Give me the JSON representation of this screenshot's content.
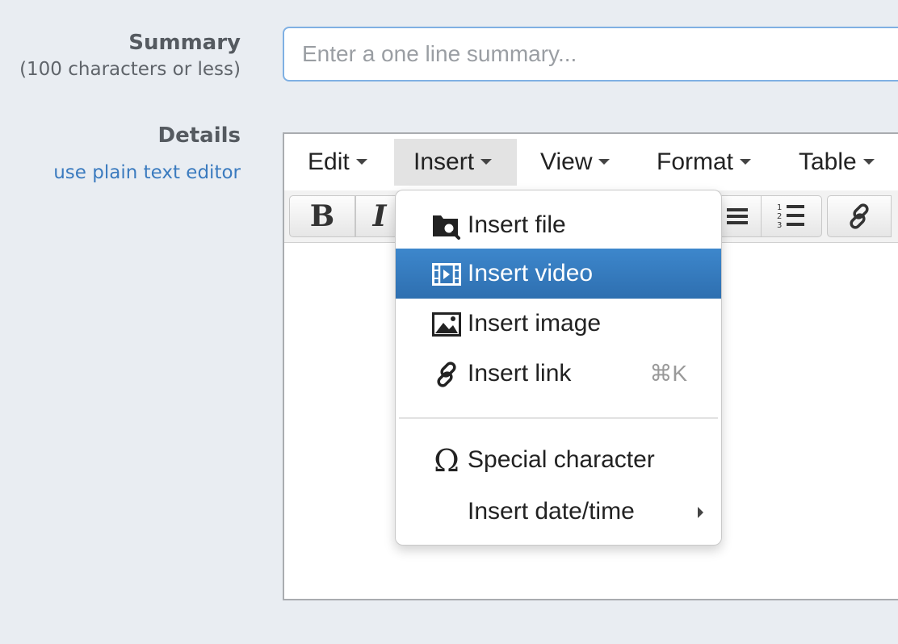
{
  "summary": {
    "label": "Summary",
    "sublabel": "(100 characters or less)",
    "placeholder": "Enter a one line summary...",
    "value": ""
  },
  "details": {
    "label": "Details",
    "plain_text_link": "use plain text editor"
  },
  "editor": {
    "menubar": [
      {
        "label": "Edit"
      },
      {
        "label": "Insert",
        "active": true
      },
      {
        "label": "View"
      },
      {
        "label": "Format"
      },
      {
        "label": "Table"
      }
    ],
    "toolbar": {
      "bold_label": "B",
      "italic_label": "I",
      "icons": [
        "bold-icon",
        "italic-icon",
        "bullet-list-icon",
        "numbered-list-icon",
        "link-icon"
      ]
    }
  },
  "insert_menu": {
    "items": [
      {
        "label": "Insert file",
        "icon": "folder-search-icon"
      },
      {
        "label": "Insert video",
        "icon": "film-icon",
        "highlighted": true
      },
      {
        "label": "Insert image",
        "icon": "image-icon"
      },
      {
        "label": "Insert link",
        "icon": "link-icon",
        "shortcut": "⌘K"
      },
      {
        "label": "Special character",
        "icon": "omega-icon"
      },
      {
        "label": "Insert date/time",
        "has_submenu": true
      }
    ]
  },
  "colors": {
    "page_background": "#e9edf2",
    "link": "#3b7bbf",
    "highlight": "#357ac0",
    "input_border": "#7fb0e3"
  }
}
